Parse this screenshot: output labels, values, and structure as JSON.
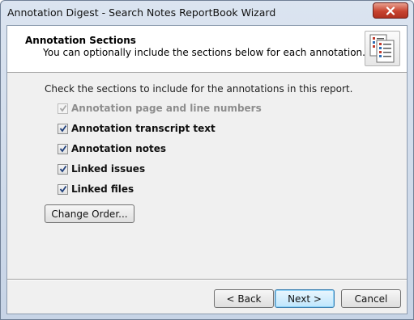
{
  "window": {
    "title": "Annotation Digest - Search Notes ReportBook Wizard"
  },
  "header": {
    "title": "Annotation Sections",
    "subtitle": "You can optionally include the sections below for each annotation.",
    "icon": "report-pages-icon"
  },
  "body": {
    "instruction": "Check the sections to include for the annotations in this report.",
    "sections": [
      {
        "label": "Annotation page and line numbers",
        "checked": true,
        "disabled": true
      },
      {
        "label": "Annotation transcript text",
        "checked": true,
        "disabled": false
      },
      {
        "label": "Annotation notes",
        "checked": true,
        "disabled": false
      },
      {
        "label": "Linked issues",
        "checked": true,
        "disabled": false
      },
      {
        "label": "Linked files",
        "checked": true,
        "disabled": false
      }
    ],
    "change_order_label": "Change Order..."
  },
  "footer": {
    "back_label": "< Back",
    "next_label": "Next >",
    "cancel_label": "Cancel"
  },
  "colors": {
    "default_button_border": "#3c7fb1",
    "close_button": "#c8432f",
    "disabled_text": "#8d8d8d"
  }
}
